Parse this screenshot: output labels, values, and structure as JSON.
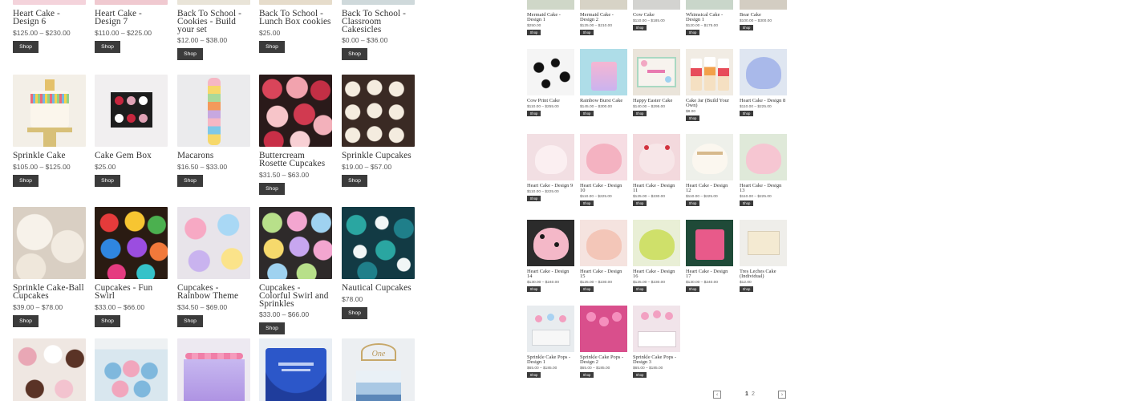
{
  "buttons": {
    "shop": "Shop"
  },
  "large_grid": {
    "row0": [
      {
        "name": "Heart Cake - Design 6",
        "price": "$125.00 – $230.00"
      },
      {
        "name": "Heart Cake - Design 7",
        "price": "$110.00 – $225.00"
      },
      {
        "name": "Back To School - Cookies - Build your set",
        "price": "$12.00 – $38.00"
      },
      {
        "name": "Back To School - Lunch Box cookies",
        "price": "$25.00"
      },
      {
        "name": "Back To School - Classroom Cakesicles",
        "price": "$0.00 – $36.00"
      }
    ],
    "row1": [
      {
        "name": "Sprinkle Cake",
        "price": "$105.00 – $125.00"
      },
      {
        "name": "Cake Gem Box",
        "price": "$25.00"
      },
      {
        "name": "Macarons",
        "price": "$16.50 – $33.00"
      },
      {
        "name": "Buttercream Rosette Cupcakes",
        "price": "$31.50 – $63.00"
      },
      {
        "name": "Sprinkle Cupcakes",
        "price": "$19.00 – $57.00"
      }
    ],
    "row2": [
      {
        "name": "Sprinkle Cake-Ball Cupcakes",
        "price": "$39.00 – $78.00"
      },
      {
        "name": "Cupcakes - Fun Swirl",
        "price": "$33.00 – $66.00"
      },
      {
        "name": "Cupcakes - Rainbow Theme",
        "price": "$34.50 – $69.00"
      },
      {
        "name": "Cupcakes - Colorful Swirl and Sprinkles",
        "price": "$33.00 – $66.00"
      },
      {
        "name": "Nautical Cupcakes",
        "price": "$78.00"
      }
    ],
    "row3_topper": "One"
  },
  "small_grid": {
    "row0": [
      {
        "name": "Mermaid Cake - Design 1",
        "price": "$250.00"
      },
      {
        "name": "Mermaid Cake - Design 2",
        "price": "$125.00 – $210.00"
      },
      {
        "name": "Cow Cake",
        "price": "$110.00 – $185.00"
      },
      {
        "name": "Whimsical Cake - Design 1",
        "price": "$120.00 – $175.00"
      },
      {
        "name": "Bear Cake",
        "price": "$100.00 – $300.00"
      }
    ],
    "row1": [
      {
        "name": "Cow Print Cake",
        "price": "$110.00 – $255.00"
      },
      {
        "name": "Rainbow Burst Cake",
        "price": "$145.00 – $300.00"
      },
      {
        "name": "Happy Easter Cake",
        "price": "$140.00 – $295.00"
      },
      {
        "name": "Cake Jar (Build Your Own)",
        "price": "$8.00"
      },
      {
        "name": "Heart Cake - Design 8",
        "price": "$110.00 – $225.00"
      }
    ],
    "row2": [
      {
        "name": "Heart Cake - Design 9",
        "price": "$110.00 – $225.00"
      },
      {
        "name": "Heart Cake - Design 10",
        "price": "$110.00 – $225.00"
      },
      {
        "name": "Heart Cake - Design 11",
        "price": "$125.00 – $230.00"
      },
      {
        "name": "Heart Cake - Design 12",
        "price": "$110.00 – $225.00"
      },
      {
        "name": "Heart Cake - Design 13",
        "price": "$110.00 – $225.00"
      }
    ],
    "row3": [
      {
        "name": "Heart Cake - Design 14",
        "price": "$130.00 – $240.00"
      },
      {
        "name": "Heart Cake - Design 15",
        "price": "$125.00 – $230.00"
      },
      {
        "name": "Heart Cake - Design 16",
        "price": "$125.00 – $230.00"
      },
      {
        "name": "Heart Cake - Design 17",
        "price": "$130.00 – $240.00"
      },
      {
        "name": "Tres Leches Cake (Individual)",
        "price": "$12.00"
      }
    ],
    "row4": [
      {
        "name": "Sprinkle Cake Pops - Design 1",
        "price": "$65.00 – $185.00"
      },
      {
        "name": "Sprinkle Cake Pops - Design 2",
        "price": "$65.00 – $185.00"
      },
      {
        "name": "Sprinkle Cake Pops - Design 3",
        "price": "$65.00 – $185.00"
      }
    ]
  },
  "pagination": {
    "prev": "‹",
    "page1": "1",
    "page2": "2",
    "next": "›"
  },
  "colors": {
    "button": "#3b3b3b",
    "text": "#333333",
    "price": "#555555"
  },
  "icons": {
    "prev": "chevron-left-icon",
    "next": "chevron-right-icon"
  }
}
